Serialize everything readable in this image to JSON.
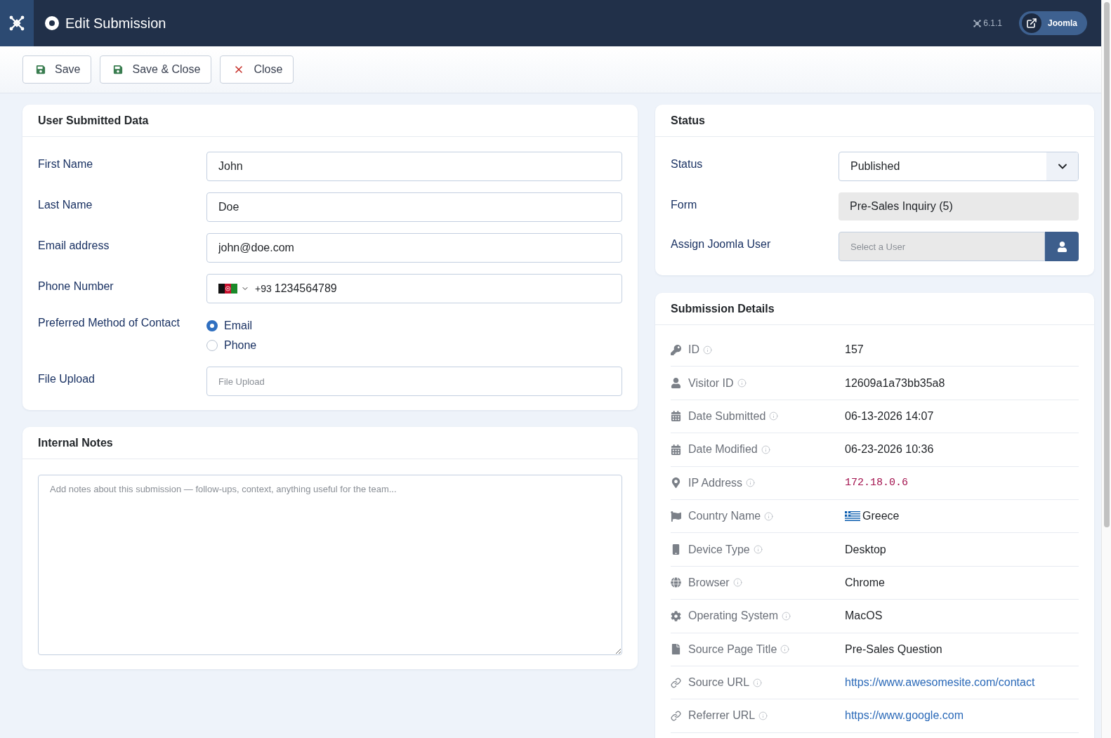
{
  "header": {
    "title": "Edit Submission",
    "version": "6.1.1",
    "site_link": "Joomla"
  },
  "toolbar": [
    {
      "kind": "save",
      "label": "Save"
    },
    {
      "kind": "save",
      "label": "Save & Close"
    },
    {
      "kind": "close",
      "label": "Close"
    }
  ],
  "user_submitted_data": {
    "title": "User Submitted Data",
    "fields": [
      {
        "kind": "text",
        "label": "First Name",
        "value": "John"
      },
      {
        "kind": "text",
        "label": "Last Name",
        "value": "Doe"
      },
      {
        "kind": "text",
        "label": "Email address",
        "value": "john@doe.com"
      },
      {
        "kind": "phone",
        "label": "Phone Number",
        "dial_code": "+93",
        "value": "1234564789"
      },
      {
        "kind": "radio",
        "label": "Preferred Method of Contact",
        "options": [
          {
            "label": "Email",
            "selected": true
          },
          {
            "label": "Phone",
            "selected": false
          }
        ]
      },
      {
        "kind": "file",
        "label": "File Upload",
        "placeholder": "File Upload"
      }
    ]
  },
  "internal_notes": {
    "title": "Internal Notes",
    "placeholder": "Add notes about this submission — follow-ups, context, anything useful for the team..."
  },
  "status": {
    "title": "Status",
    "fields": [
      {
        "kind": "select",
        "label": "Status",
        "value": "Published"
      },
      {
        "kind": "readonly",
        "label": "Form",
        "value": "Pre-Sales Inquiry (5)"
      },
      {
        "kind": "user",
        "label": "Assign Joomla User",
        "placeholder": "Select a User"
      }
    ]
  },
  "submission_details": {
    "title": "Submission Details",
    "rows": [
      {
        "kind": "text",
        "label": "ID",
        "value": "157"
      },
      {
        "kind": "text",
        "label": "Visitor ID",
        "value": "12609a1a73bb35a8"
      },
      {
        "kind": "text",
        "label": "Date Submitted",
        "value": "06-13-2026 14:07"
      },
      {
        "kind": "text",
        "label": "Date Modified",
        "value": "06-23-2026 10:36"
      },
      {
        "kind": "code",
        "label": "IP Address",
        "value": "172.18.0.6"
      },
      {
        "kind": "country",
        "label": "Country Name",
        "value": "Greece"
      },
      {
        "kind": "text",
        "label": "Device Type",
        "value": "Desktop"
      },
      {
        "kind": "text",
        "label": "Browser",
        "value": "Chrome"
      },
      {
        "kind": "text",
        "label": "Operating System",
        "value": "MacOS"
      },
      {
        "kind": "text",
        "label": "Source Page Title",
        "value": "Pre-Sales Question"
      },
      {
        "kind": "link",
        "label": "Source URL",
        "value": "https://www.awesomesite.com/contact"
      },
      {
        "kind": "link",
        "label": "Referrer URL",
        "value": "https://www.google.com"
      }
    ]
  }
}
